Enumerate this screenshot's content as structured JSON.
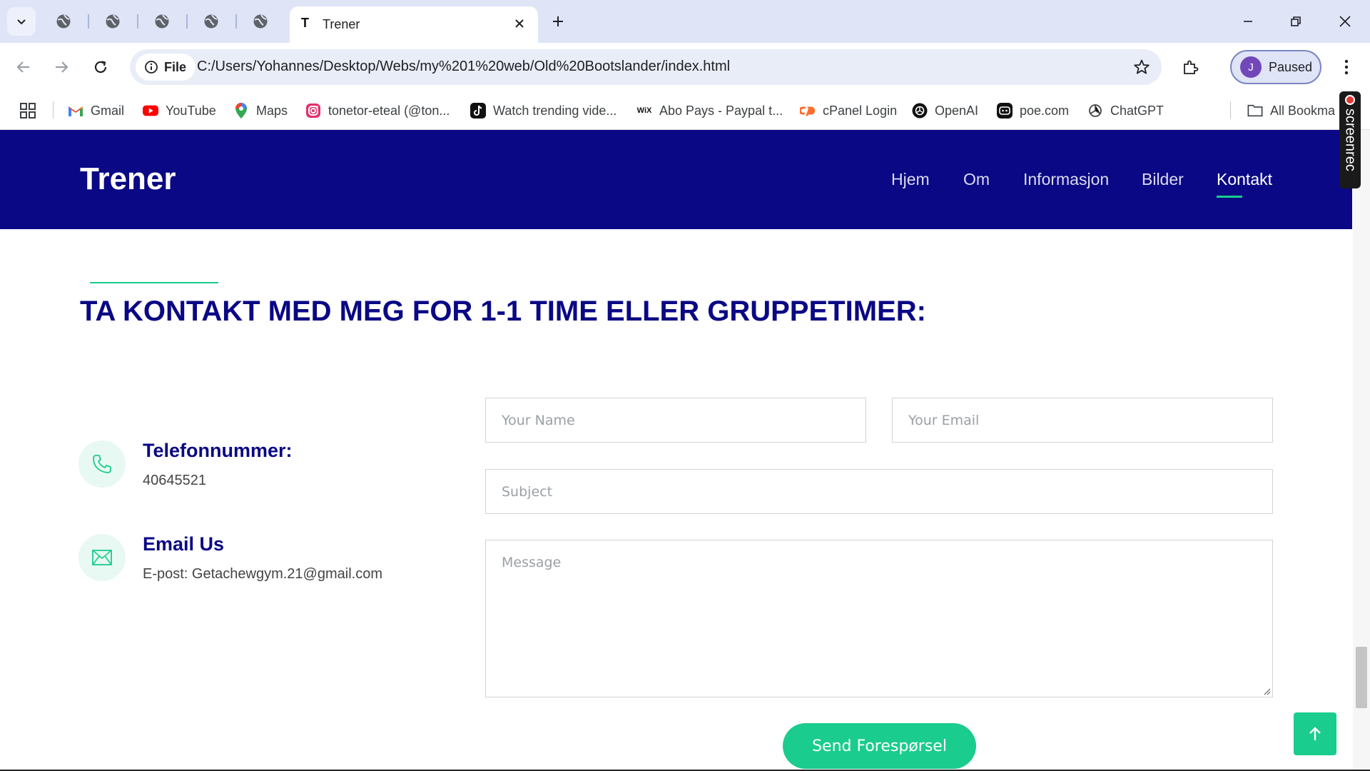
{
  "browser": {
    "tab_title": "Trener",
    "tab_favicon_letter": "T",
    "site_chip_label": "File",
    "url": "C:/Users/Yohannes/Desktop/Webs/my%201%20web/Old%20Bootslander/index.html",
    "profile_initial": "J",
    "profile_status": "Paused",
    "bookmarks": [
      {
        "label": "Gmail",
        "icon": "gmail-icon"
      },
      {
        "label": "YouTube",
        "icon": "youtube-icon"
      },
      {
        "label": "Maps",
        "icon": "maps-icon"
      },
      {
        "label": "tonetor-eteal (@ton...",
        "icon": "instagram-icon"
      },
      {
        "label": "Watch trending vide...",
        "icon": "tiktok-icon"
      },
      {
        "label": "Abo Pays - Paypal t...",
        "icon": "wix-icon"
      },
      {
        "label": "cPanel Login",
        "icon": "cpanel-icon"
      },
      {
        "label": "OpenAI",
        "icon": "openai-icon"
      },
      {
        "label": "poe.com",
        "icon": "poe-icon"
      },
      {
        "label": "ChatGPT",
        "icon": "chatgpt-icon"
      }
    ],
    "all_bookmarks_label": "All Bookma",
    "wix_badge": "WiX",
    "screenrec_label": "screenrec"
  },
  "site": {
    "logo": "Trener",
    "nav": [
      "Hjem",
      "Om",
      "Informasjon",
      "Bilder",
      "Kontakt"
    ],
    "active_nav": "Kontakt"
  },
  "contact": {
    "title": "TA KONTAKT MED MEG FOR 1-1 TIME ELLER GRUPPETIMER:",
    "phone_heading": "Telefonnummer:",
    "phone_value": "40645521",
    "email_heading": "Email Us",
    "email_value": "E-post: Getachewgym.21@gmail.com"
  },
  "form": {
    "name_placeholder": "Your Name",
    "email_placeholder": "Your Email",
    "subject_placeholder": "Subject",
    "message_placeholder": "Message",
    "submit_label": "Send Forespørsel"
  },
  "colors": {
    "navy": "#0a0884",
    "accent": "#1acc8d"
  }
}
